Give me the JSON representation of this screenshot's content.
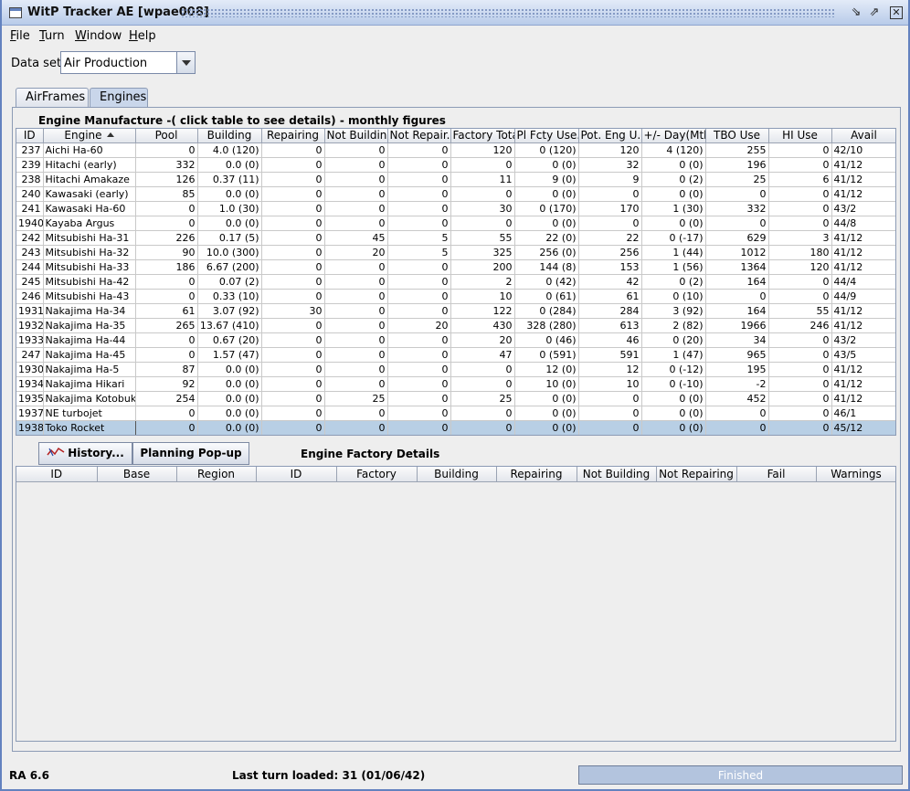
{
  "window": {
    "title": "WitP Tracker AE [wpae008]"
  },
  "menu": [
    {
      "mnemonic": "F",
      "rest": "ile"
    },
    {
      "mnemonic": "T",
      "rest": "urn"
    },
    {
      "mnemonic": "W",
      "rest": "indow"
    },
    {
      "mnemonic": "H",
      "rest": "elp"
    }
  ],
  "dataset": {
    "label": "Data set:",
    "value": "Air Production"
  },
  "tabs": [
    {
      "label": "AirFrames",
      "selected": false
    },
    {
      "label": "Engines",
      "selected": true
    }
  ],
  "engines": {
    "title": "Engine Manufacture -( click table to see details) - monthly figures",
    "columns": [
      "ID",
      "Engine",
      "Pool",
      "Building",
      "Repairing",
      "Not Building",
      "Not Repair...",
      "Factory Total",
      "Pl Fcty Use...",
      "Pot. Eng U...",
      "+/- Day(Mth)",
      "TBO Use",
      "HI Use",
      "Avail"
    ],
    "sorted_column": "Engine",
    "rows": [
      [
        "237",
        "Aichi Ha-60",
        "0",
        "4.0 (120)",
        "0",
        "0",
        "0",
        "120",
        "0 (120)",
        "120",
        "4 (120)",
        "255",
        "0",
        "42/10"
      ],
      [
        "239",
        "Hitachi (early)",
        "332",
        "0.0 (0)",
        "0",
        "0",
        "0",
        "0",
        "0 (0)",
        "32",
        "0 (0)",
        "196",
        "0",
        "41/12"
      ],
      [
        "238",
        "Hitachi Amakaze",
        "126",
        "0.37 (11)",
        "0",
        "0",
        "0",
        "11",
        "9 (0)",
        "9",
        "0 (2)",
        "25",
        "6",
        "41/12"
      ],
      [
        "240",
        "Kawasaki (early)",
        "85",
        "0.0 (0)",
        "0",
        "0",
        "0",
        "0",
        "0 (0)",
        "0",
        "0 (0)",
        "0",
        "0",
        "41/12"
      ],
      [
        "241",
        "Kawasaki Ha-60",
        "0",
        "1.0 (30)",
        "0",
        "0",
        "0",
        "30",
        "0 (170)",
        "170",
        "1 (30)",
        "332",
        "0",
        "43/2"
      ],
      [
        "1940",
        "Kayaba Argus",
        "0",
        "0.0 (0)",
        "0",
        "0",
        "0",
        "0",
        "0 (0)",
        "0",
        "0 (0)",
        "0",
        "0",
        "44/8"
      ],
      [
        "242",
        "Mitsubishi Ha-31",
        "226",
        "0.17 (5)",
        "0",
        "45",
        "5",
        "55",
        "22 (0)",
        "22",
        "0 (-17)",
        "629",
        "3",
        "41/12"
      ],
      [
        "243",
        "Mitsubishi Ha-32",
        "90",
        "10.0 (300)",
        "0",
        "20",
        "5",
        "325",
        "256 (0)",
        "256",
        "1 (44)",
        "1012",
        "180",
        "41/12"
      ],
      [
        "244",
        "Mitsubishi Ha-33",
        "186",
        "6.67 (200)",
        "0",
        "0",
        "0",
        "200",
        "144 (8)",
        "153",
        "1 (56)",
        "1364",
        "120",
        "41/12"
      ],
      [
        "245",
        "Mitsubishi Ha-42",
        "0",
        "0.07 (2)",
        "0",
        "0",
        "0",
        "2",
        "0 (42)",
        "42",
        "0 (2)",
        "164",
        "0",
        "44/4"
      ],
      [
        "246",
        "Mitsubishi Ha-43",
        "0",
        "0.33 (10)",
        "0",
        "0",
        "0",
        "10",
        "0 (61)",
        "61",
        "0 (10)",
        "0",
        "0",
        "44/9"
      ],
      [
        "1931",
        "Nakajima Ha-34",
        "61",
        "3.07 (92)",
        "30",
        "0",
        "0",
        "122",
        "0 (284)",
        "284",
        "3 (92)",
        "164",
        "55",
        "41/12"
      ],
      [
        "1932",
        "Nakajima Ha-35",
        "265",
        "13.67 (410)",
        "0",
        "0",
        "20",
        "430",
        "328 (280)",
        "613",
        "2 (82)",
        "1966",
        "246",
        "41/12"
      ],
      [
        "1933",
        "Nakajima Ha-44",
        "0",
        "0.67 (20)",
        "0",
        "0",
        "0",
        "20",
        "0 (46)",
        "46",
        "0 (20)",
        "34",
        "0",
        "43/2"
      ],
      [
        "247",
        "Nakajima Ha-45",
        "0",
        "1.57 (47)",
        "0",
        "0",
        "0",
        "47",
        "0 (591)",
        "591",
        "1 (47)",
        "965",
        "0",
        "43/5"
      ],
      [
        "1930",
        "Nakajima Ha-5",
        "87",
        "0.0 (0)",
        "0",
        "0",
        "0",
        "0",
        "12 (0)",
        "12",
        "0 (-12)",
        "195",
        "0",
        "41/12"
      ],
      [
        "1934",
        "Nakajima Hikari",
        "92",
        "0.0 (0)",
        "0",
        "0",
        "0",
        "0",
        "10 (0)",
        "10",
        "0 (-10)",
        "-2",
        "0",
        "41/12"
      ],
      [
        "1935",
        "Nakajima Kotobuki",
        "254",
        "0.0 (0)",
        "0",
        "25",
        "0",
        "25",
        "0 (0)",
        "0",
        "0 (0)",
        "452",
        "0",
        "41/12"
      ],
      [
        "1937",
        "NE turbojet",
        "0",
        "0.0 (0)",
        "0",
        "0",
        "0",
        "0",
        "0 (0)",
        "0",
        "0 (0)",
        "0",
        "0",
        "46/1"
      ],
      [
        "1938",
        "Toko Rocket",
        "0",
        "0.0 (0)",
        "0",
        "0",
        "0",
        "0",
        "0 (0)",
        "0",
        "0 (0)",
        "0",
        "0",
        "45/12"
      ]
    ],
    "selected_row": 19
  },
  "buttons": {
    "history": "History...",
    "planning": "Planning Pop-up"
  },
  "factory": {
    "title": "Engine Factory Details",
    "columns": [
      "ID",
      "Base",
      "Region",
      "ID",
      "Factory",
      "Building",
      "Repairing",
      "Not Building",
      "Not Repairing",
      "Fail",
      "Warnings"
    ]
  },
  "status": {
    "version": "RA 6.6",
    "last_turn": "Last turn loaded: 31 (01/06/42)",
    "progress_label": "Finished",
    "progress_fraction": 1.0
  },
  "colors": {
    "titlebar": "#b8cbe9",
    "selected_row": "#b8cfe5",
    "border": "#6382bf"
  },
  "icons": [
    "app-window-icon",
    "minimize-icon",
    "maximize-icon",
    "close-icon",
    "dropdown-arrow-icon",
    "sort-ascending-icon",
    "history-chart-icon"
  ]
}
